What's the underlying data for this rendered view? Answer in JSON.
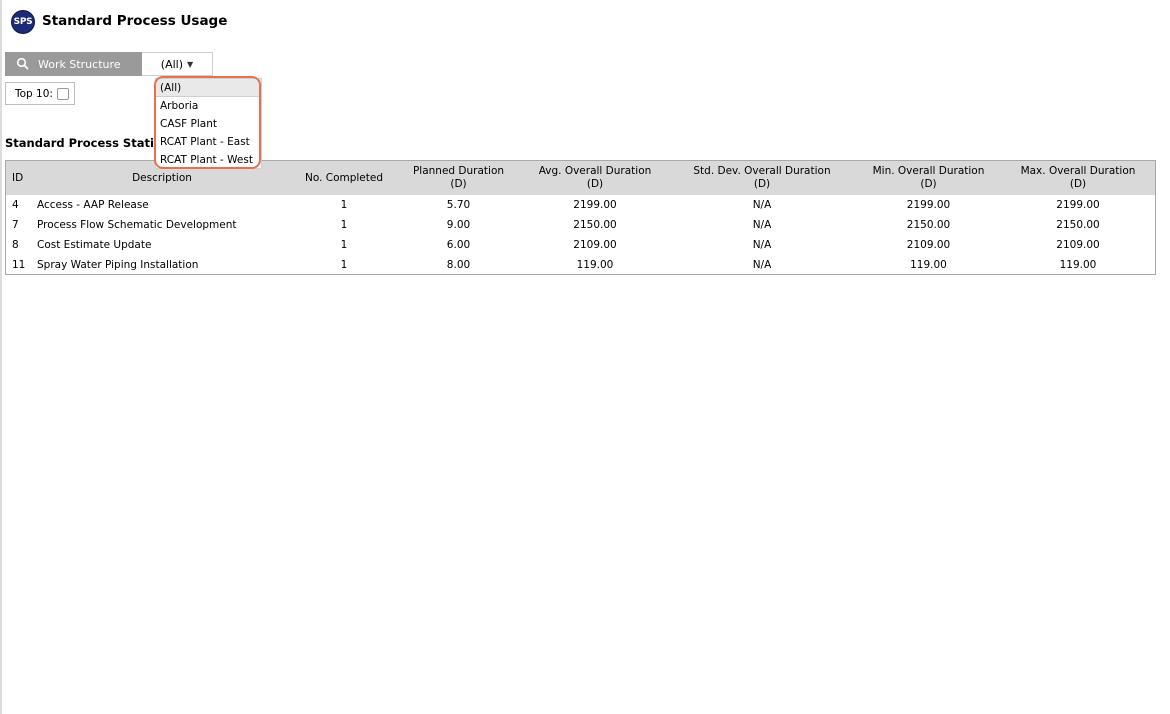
{
  "app": {
    "logo_text": "SPS",
    "title": "Standard Process Usage"
  },
  "filter": {
    "label": "Work Structure",
    "value": "(All)",
    "caret": "▼",
    "icon": "search-icon"
  },
  "top10": {
    "label": "Top 10:",
    "checked": false
  },
  "section": {
    "title": "Standard Process Stati"
  },
  "dropdown": {
    "options": [
      "(All)",
      "Arboria",
      "CASF Plant",
      "RCAT Plant - East",
      "RCAT Plant - West"
    ],
    "selected": "(All)"
  },
  "table": {
    "headers": {
      "id": "ID",
      "description": "Description",
      "no_completed": "No. Completed",
      "planned_duration": "Planned Duration",
      "planned_duration_unit": "(D)",
      "avg_duration": "Avg. Overall Duration",
      "avg_duration_unit": "(D)",
      "std_dev_duration": "Std. Dev. Overall Duration",
      "std_dev_duration_unit": "(D)",
      "min_duration": "Min. Overall Duration",
      "min_duration_unit": "(D)",
      "max_duration": "Max. Overall Duration",
      "max_duration_unit": "(D)"
    },
    "rows": [
      {
        "id": "4",
        "description": "Access - AAP Release",
        "no_completed": "1",
        "planned": "5.70",
        "avg": "2199.00",
        "std": "N/A",
        "min": "2199.00",
        "max": "2199.00"
      },
      {
        "id": "7",
        "description": "Process Flow Schematic Development",
        "no_completed": "1",
        "planned": "9.00",
        "avg": "2150.00",
        "std": "N/A",
        "min": "2150.00",
        "max": "2150.00"
      },
      {
        "id": "8",
        "description": "Cost Estimate Update",
        "no_completed": "1",
        "planned": "6.00",
        "avg": "2109.00",
        "std": "N/A",
        "min": "2109.00",
        "max": "2109.00"
      },
      {
        "id": "11",
        "description": "Spray Water Piping Installation",
        "no_completed": "1",
        "planned": "8.00",
        "avg": "119.00",
        "std": "N/A",
        "min": "119.00",
        "max": "119.00"
      }
    ]
  },
  "colors": {
    "logo_bg": "#1d2a78",
    "filter_label_bg": "#9a9a9a",
    "header_bg": "#d9d9d9",
    "highlight": "#e8704a"
  }
}
